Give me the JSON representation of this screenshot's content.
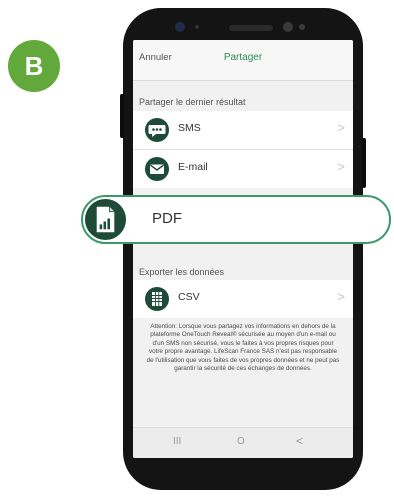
{
  "step": {
    "letter": "B"
  },
  "header": {
    "cancel_label": "Annuler",
    "title": "Partager"
  },
  "sections": {
    "last_result_label": "Partager le dernier résultat",
    "export_label": "Exporter les données"
  },
  "share_options": [
    {
      "label": "SMS",
      "icon": "sms-bubble-icon"
    },
    {
      "label": "E-mail",
      "icon": "envelope-icon"
    }
  ],
  "pdf_option": {
    "label": "PDF",
    "icon": "pdf-chart-icon"
  },
  "export_options": [
    {
      "label": "CSV",
      "icon": "spreadsheet-icon"
    }
  ],
  "chevron": ">",
  "disclaimer": "Attention: Lorsque vous partagez vos informations en dehors de la plateforme OneTouch Reveal® sécurisée au moyen d'un e-mail ou d'un SMS non sécurisé, vous le faites à vos propres risques pour votre propre avantage. LifeScan France SAS n'est pas responsable de l'utilisation que vous faites de vos propres données et ne peut pas garantir la sécurité de ces échanges de données.",
  "navbar": {
    "recents": "III",
    "home": "O",
    "back": "<"
  },
  "colors": {
    "green": "#2e8b57",
    "badge": "#62a83b",
    "outline": "#3a9a6e"
  }
}
